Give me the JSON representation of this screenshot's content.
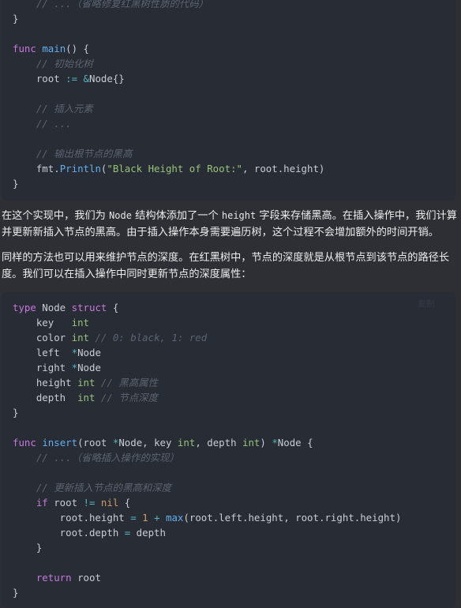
{
  "code_block_1": {
    "lines": [
      [
        {
          "c": "cm",
          "t": "    // ...（省略修复红黑树性质的代码）"
        }
      ],
      [
        {
          "c": "",
          "t": "}"
        }
      ],
      [
        {
          "c": "",
          "t": ""
        }
      ],
      [
        {
          "c": "kw",
          "t": "func"
        },
        {
          "c": "",
          "t": " "
        },
        {
          "c": "fn",
          "t": "main"
        },
        {
          "c": "",
          "t": "() {"
        }
      ],
      [
        {
          "c": "cm",
          "t": "    // 初始化树"
        }
      ],
      [
        {
          "c": "",
          "t": "    root "
        },
        {
          "c": "op",
          "t": ":="
        },
        {
          "c": "",
          "t": " "
        },
        {
          "c": "op",
          "t": "&"
        },
        {
          "c": "",
          "t": "Node{}"
        }
      ],
      [
        {
          "c": "",
          "t": ""
        }
      ],
      [
        {
          "c": "cm",
          "t": "    // 插入元素"
        }
      ],
      [
        {
          "c": "cm",
          "t": "    // ..."
        }
      ],
      [
        {
          "c": "",
          "t": ""
        }
      ],
      [
        {
          "c": "cm",
          "t": "    // 输出根节点的黑高"
        }
      ],
      [
        {
          "c": "",
          "t": "    fmt."
        },
        {
          "c": "fn",
          "t": "Println"
        },
        {
          "c": "",
          "t": "("
        },
        {
          "c": "str",
          "t": "\"Black Height of Root:\""
        },
        {
          "c": "",
          "t": ", root.height)"
        }
      ],
      [
        {
          "c": "",
          "t": "}"
        }
      ]
    ]
  },
  "paragraph_1": {
    "parts": [
      "在这个实现中，我们为 ",
      "Node",
      " 结构体添加了一个 ",
      "height",
      " 字段来存储黑高。在插入操作中，我们计算并更新新插入节点的黑高。由于插入操作本身需要遍历树，这个过程不会增加额外的时间开销。"
    ]
  },
  "paragraph_2": {
    "text": "同样的方法也可以用来维护节点的深度。在红黑树中，节点的深度就是从根节点到该节点的路径长度。我们可以在插入操作中同时更新节点的深度属性："
  },
  "code_block_2": {
    "copy_label": "复制",
    "lines": [
      [
        {
          "c": "kw",
          "t": "type"
        },
        {
          "c": "",
          "t": " Node "
        },
        {
          "c": "kw",
          "t": "struct"
        },
        {
          "c": "",
          "t": " {"
        }
      ],
      [
        {
          "c": "",
          "t": "    key   "
        },
        {
          "c": "ty",
          "t": "int"
        }
      ],
      [
        {
          "c": "",
          "t": "    color "
        },
        {
          "c": "ty",
          "t": "int"
        },
        {
          "c": "",
          "t": " "
        },
        {
          "c": "cm",
          "t": "// 0: black, 1: red"
        }
      ],
      [
        {
          "c": "",
          "t": "    left  "
        },
        {
          "c": "op",
          "t": "*"
        },
        {
          "c": "",
          "t": "Node"
        }
      ],
      [
        {
          "c": "",
          "t": "    right "
        },
        {
          "c": "op",
          "t": "*"
        },
        {
          "c": "",
          "t": "Node"
        }
      ],
      [
        {
          "c": "",
          "t": "    height "
        },
        {
          "c": "ty",
          "t": "int"
        },
        {
          "c": "",
          "t": " "
        },
        {
          "c": "cm",
          "t": "// 黑高属性"
        }
      ],
      [
        {
          "c": "",
          "t": "    depth  "
        },
        {
          "c": "ty",
          "t": "int"
        },
        {
          "c": "",
          "t": " "
        },
        {
          "c": "cm",
          "t": "// 节点深度"
        }
      ],
      [
        {
          "c": "",
          "t": "}"
        }
      ],
      [
        {
          "c": "",
          "t": ""
        }
      ],
      [
        {
          "c": "kw",
          "t": "func"
        },
        {
          "c": "",
          "t": " "
        },
        {
          "c": "fn",
          "t": "insert"
        },
        {
          "c": "",
          "t": "(root "
        },
        {
          "c": "op",
          "t": "*"
        },
        {
          "c": "",
          "t": "Node, key "
        },
        {
          "c": "ty",
          "t": "int"
        },
        {
          "c": "",
          "t": ", depth "
        },
        {
          "c": "ty",
          "t": "int"
        },
        {
          "c": "",
          "t": ") "
        },
        {
          "c": "op",
          "t": "*"
        },
        {
          "c": "",
          "t": "Node {"
        }
      ],
      [
        {
          "c": "cm",
          "t": "    // ...（省略插入操作的实现）"
        }
      ],
      [
        {
          "c": "",
          "t": ""
        }
      ],
      [
        {
          "c": "cm",
          "t": "    // 更新插入节点的黑高和深度"
        }
      ],
      [
        {
          "c": "",
          "t": "    "
        },
        {
          "c": "kw",
          "t": "if"
        },
        {
          "c": "",
          "t": " root "
        },
        {
          "c": "op",
          "t": "!="
        },
        {
          "c": "",
          "t": " "
        },
        {
          "c": "num",
          "t": "nil"
        },
        {
          "c": "",
          "t": " {"
        }
      ],
      [
        {
          "c": "",
          "t": "        root.height "
        },
        {
          "c": "op",
          "t": "="
        },
        {
          "c": "",
          "t": " "
        },
        {
          "c": "num",
          "t": "1"
        },
        {
          "c": "",
          "t": " "
        },
        {
          "c": "op",
          "t": "+"
        },
        {
          "c": "",
          "t": " "
        },
        {
          "c": "fn",
          "t": "max"
        },
        {
          "c": "",
          "t": "(root.left.height, root.right.height)"
        }
      ],
      [
        {
          "c": "",
          "t": "        root.depth "
        },
        {
          "c": "op",
          "t": "="
        },
        {
          "c": "",
          "t": " depth"
        }
      ],
      [
        {
          "c": "",
          "t": "    }"
        }
      ],
      [
        {
          "c": "",
          "t": ""
        }
      ],
      [
        {
          "c": "",
          "t": "    "
        },
        {
          "c": "kw",
          "t": "return"
        },
        {
          "c": "",
          "t": " root"
        }
      ],
      [
        {
          "c": "",
          "t": "}"
        }
      ]
    ]
  }
}
